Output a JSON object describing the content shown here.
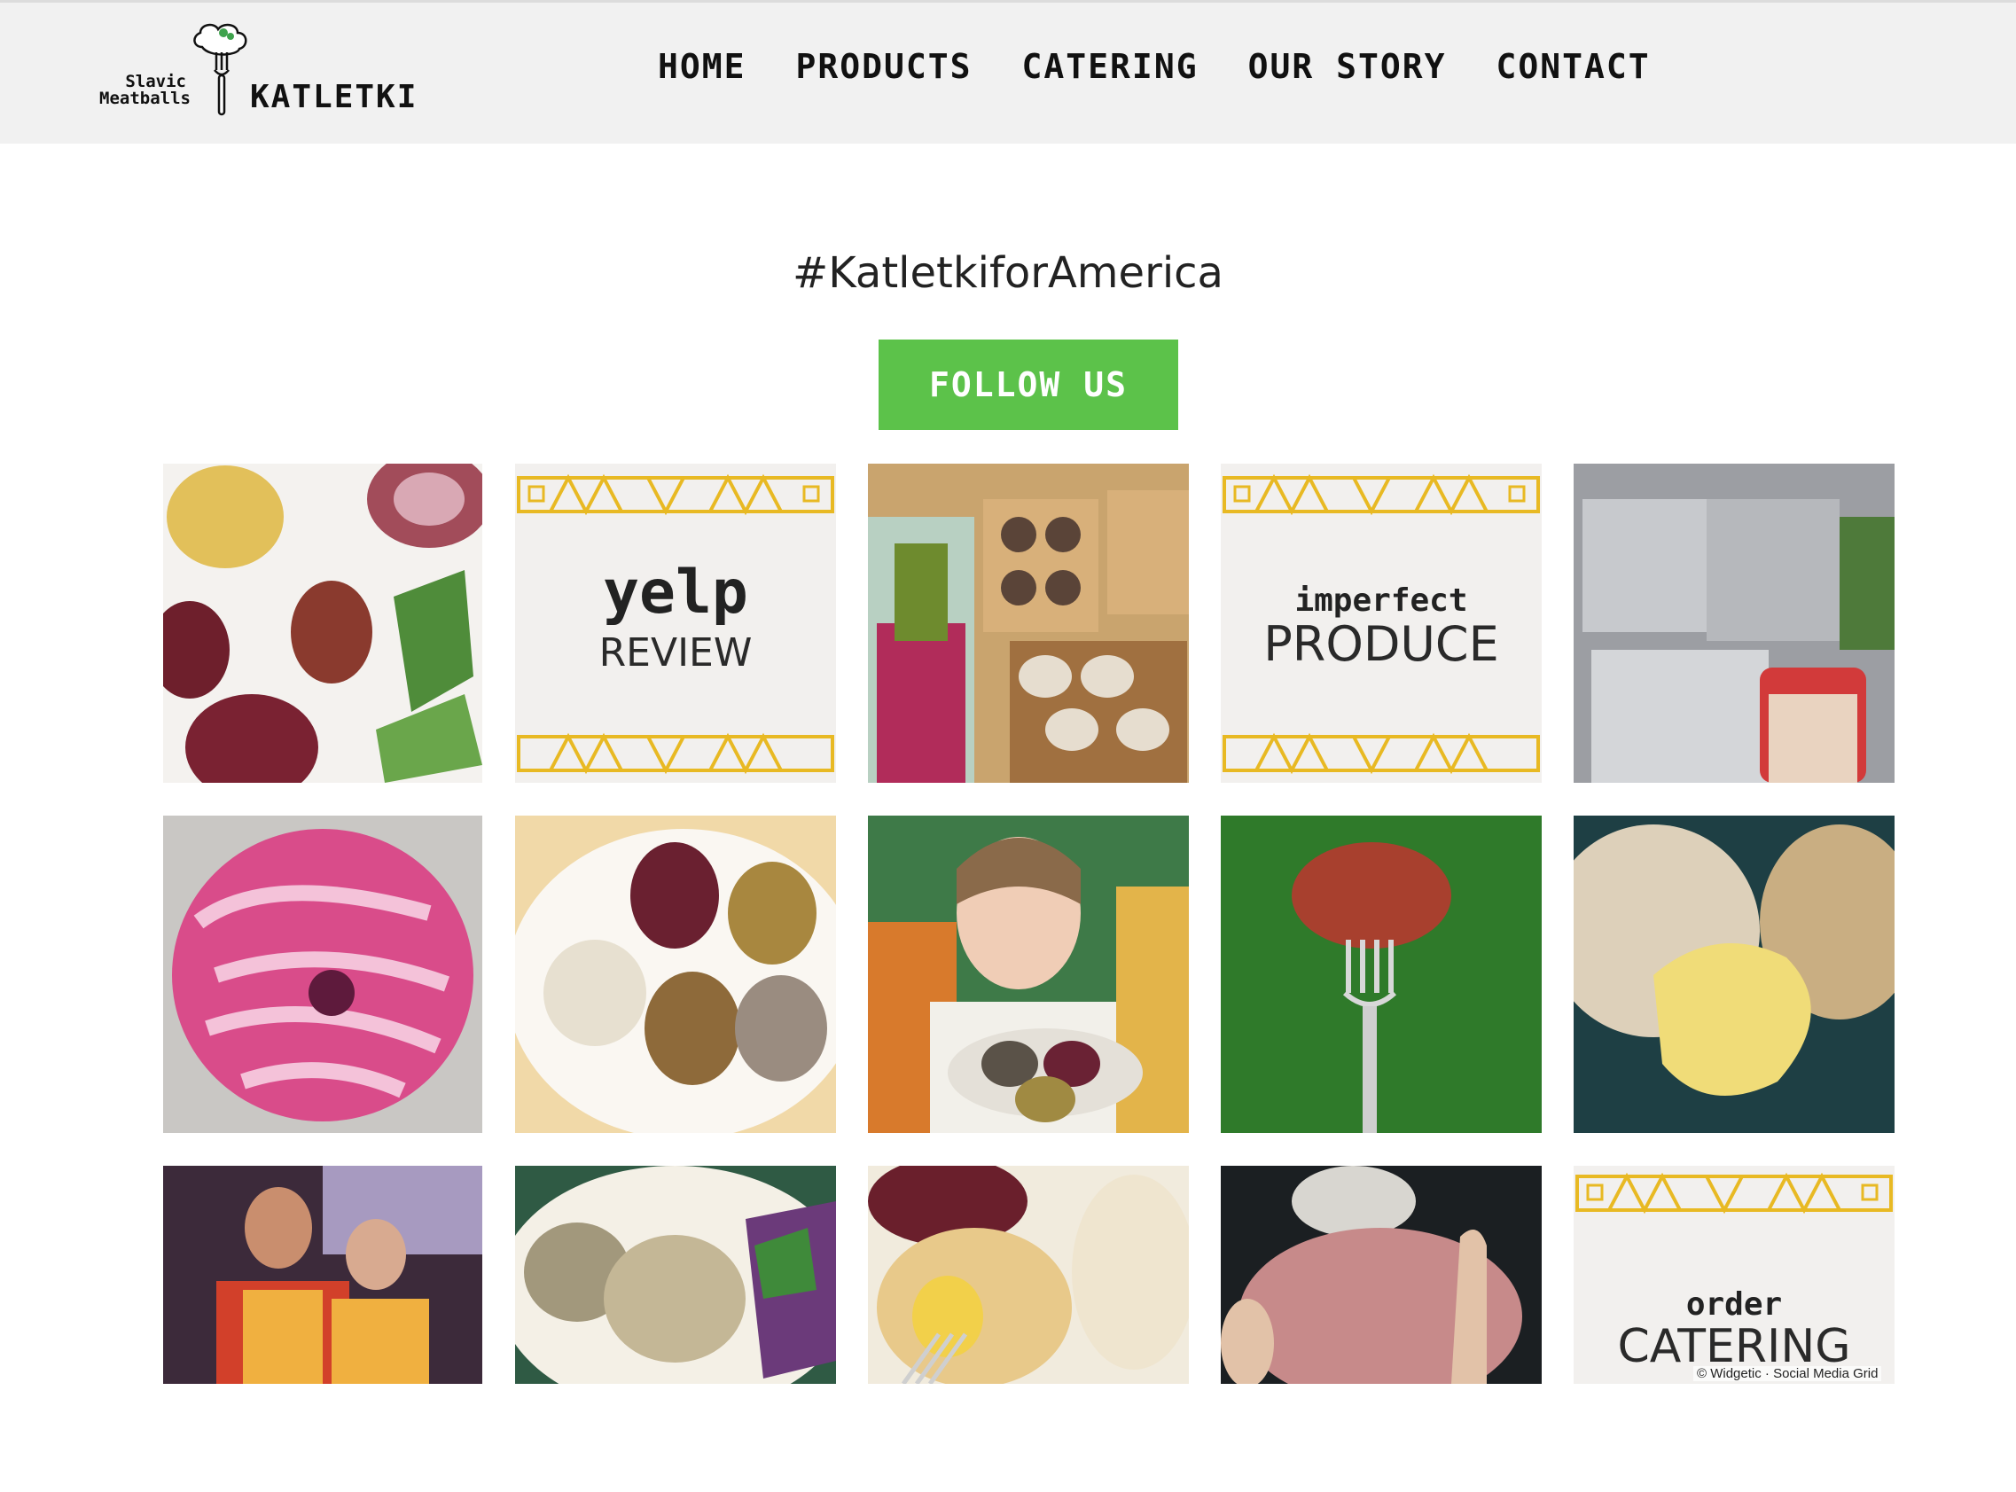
{
  "header": {
    "logo_small_line1": "Slavic",
    "logo_small_line2": "Meatballs",
    "brand": "KATLETKI",
    "nav": [
      "HOME",
      "PRODUCTS",
      "CATERING",
      "OUR STORY",
      "CONTACT"
    ]
  },
  "hashtag": "#KatletkiforAmerica",
  "follow_label": "FOLLOW US",
  "colors": {
    "accent": "#5cc24a",
    "pattern": "#e8b923",
    "header_bg": "#f1f1f1"
  },
  "grid": {
    "cards": {
      "yelp_title": "yelp",
      "yelp_sub": "REVIEW",
      "imperfect_title": "imperfect",
      "imperfect_sub": "PRODUCE",
      "order_title": "order",
      "order_sub": "CATERING"
    },
    "photos": [
      "vegetables-and-meatball-photo",
      "meatball-trays-photo",
      "foil-containers-photo",
      "pickled-onions-photo",
      "meatball-plate-photo",
      "woman-holding-meatballs-photo",
      "meatball-on-fork-photo",
      "cheese-filled-meatball-photo",
      "couple-in-aprons-photo",
      "meatballs-with-salad-photo",
      "cut-meatball-with-fork-photo",
      "ground-meat-photo"
    ]
  },
  "credit": "© Widgetic · Social Media Grid"
}
